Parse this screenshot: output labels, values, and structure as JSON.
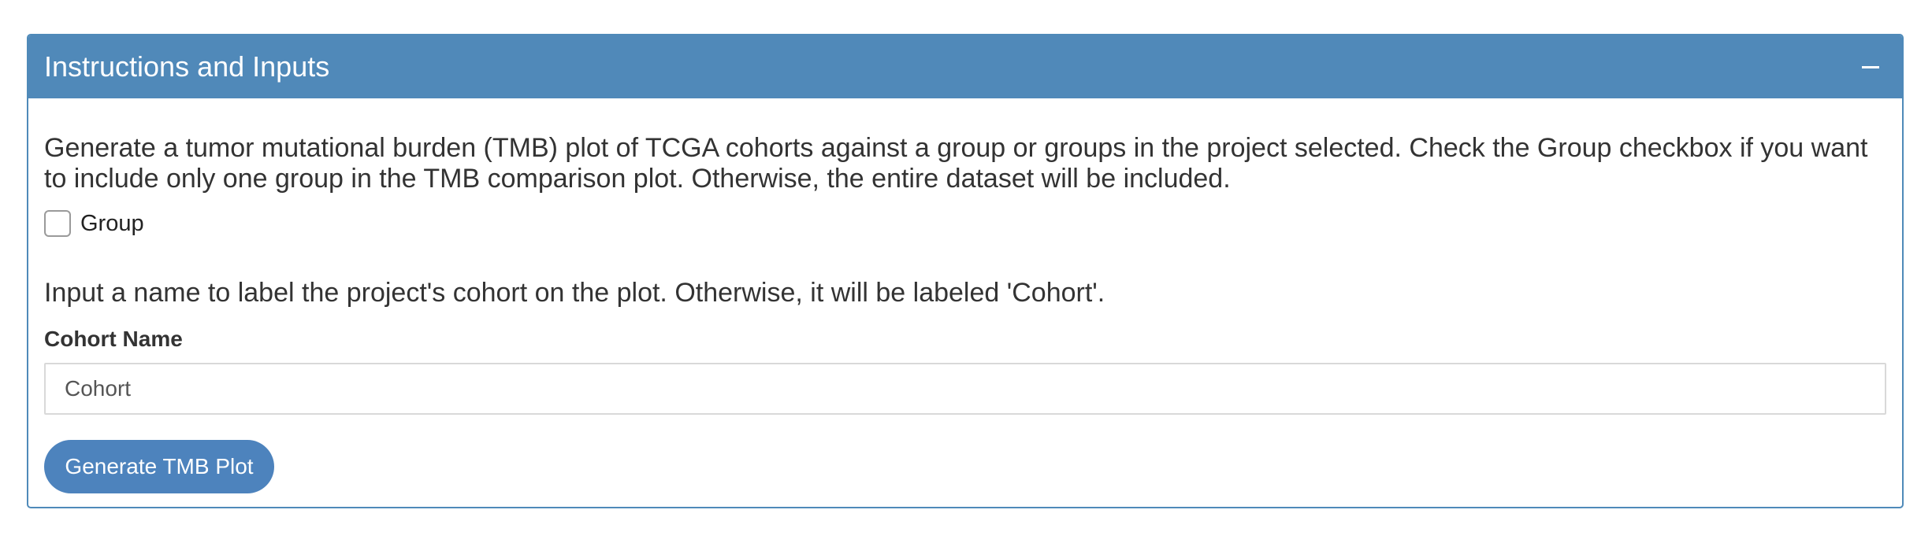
{
  "panel": {
    "title": "Instructions and Inputs",
    "collapse_icon": "minus-icon",
    "header_color": "#5089b9"
  },
  "instructions": {
    "intro": "Generate a tumor mutational burden (TMB) plot of TCGA cohorts against a group or groups in the project selected. Check the Group checkbox if you want to include only one group in the TMB comparison plot. Otherwise, the entire dataset will be included.",
    "cohort_instruction": "Input a name to label the project's cohort on the plot. Otherwise, it will be labeled 'Cohort'."
  },
  "group_checkbox": {
    "label": "Group",
    "checked": false
  },
  "cohort_field": {
    "label": "Cohort Name",
    "value": "Cohort"
  },
  "actions": {
    "generate_label": "Generate TMB Plot",
    "button_color": "#4d83bd"
  }
}
